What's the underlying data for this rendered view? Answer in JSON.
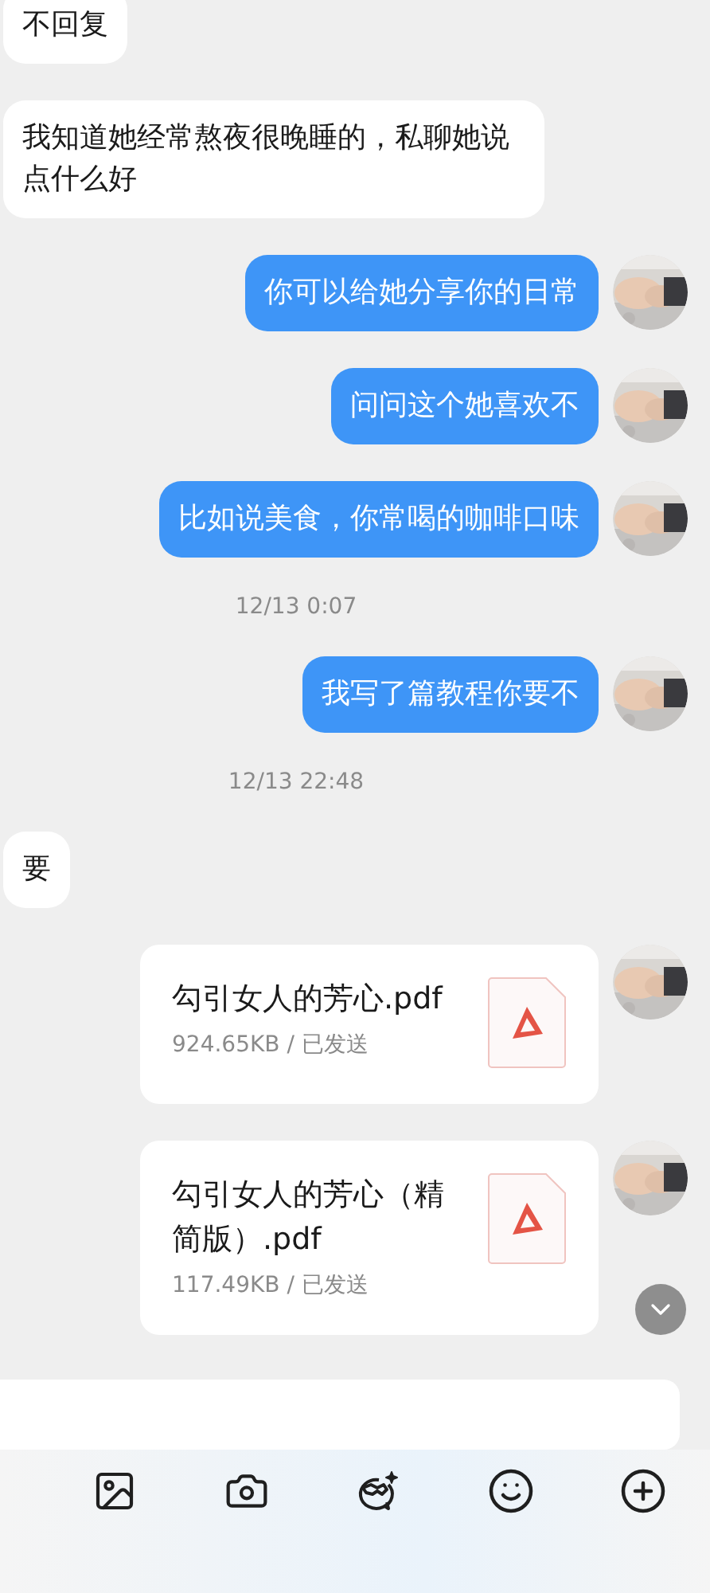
{
  "messages": [
    {
      "kind": "text",
      "outgoing": false,
      "text": "不回复"
    },
    {
      "kind": "text",
      "outgoing": false,
      "text": "我知道她经常熬夜很晚睡的，私聊她说点什么好"
    },
    {
      "kind": "text",
      "outgoing": true,
      "text": "你可以给她分享你的日常"
    },
    {
      "kind": "text",
      "outgoing": true,
      "text": "问问这个她喜欢不"
    },
    {
      "kind": "text",
      "outgoing": true,
      "text": "比如说美食，你常喝的咖啡口味"
    },
    {
      "kind": "time",
      "text": "12/13 0:07"
    },
    {
      "kind": "text",
      "outgoing": true,
      "text": "我写了篇教程你要不"
    },
    {
      "kind": "time",
      "text": "12/13 22:48"
    },
    {
      "kind": "text",
      "outgoing": false,
      "text": "要"
    },
    {
      "kind": "file",
      "outgoing": true,
      "name": "勾引女人的芳心.pdf",
      "meta": "924.65KB / 已发送"
    },
    {
      "kind": "file",
      "outgoing": true,
      "name": "勾引女人的芳心（精简版）.pdf",
      "meta": "117.49KB / 已发送"
    }
  ]
}
